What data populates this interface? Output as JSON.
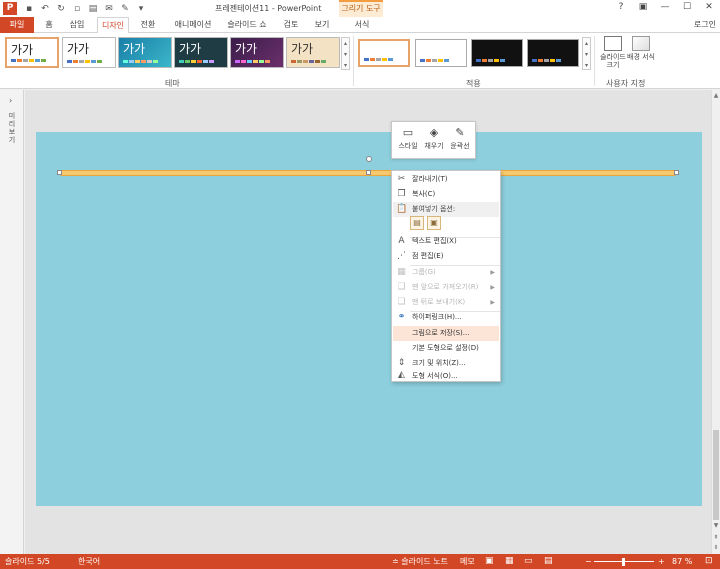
{
  "titlebar": {
    "app_icon": "P",
    "title": "프레젠테이션11 - PowerPoint",
    "contextual_group": "그리기 도구",
    "qat_icons": [
      "save-icon",
      "undo-icon",
      "redo-icon",
      "new-icon",
      "open-icon",
      "email-icon",
      "draw-icon",
      "customize-icon"
    ],
    "win_help": "?",
    "win_restore": "▣",
    "win_minimize": "—",
    "win_maximize": "☐",
    "win_close": "✕"
  },
  "tabs": [
    {
      "label": "파일"
    },
    {
      "label": "홈"
    },
    {
      "label": "삽입"
    },
    {
      "label": "디자인"
    },
    {
      "label": "전환"
    },
    {
      "label": "애니메이션"
    },
    {
      "label": "슬라이드 쇼"
    },
    {
      "label": "검토"
    },
    {
      "label": "보기"
    },
    {
      "label": "서식"
    }
  ],
  "login": "로그인",
  "ribbon": {
    "theme_sample_text": "가가",
    "themes_label": "테마",
    "variants_label": "적용",
    "slide_size_label": "슬라이드 크기",
    "background_label": "배경 서식",
    "customize_label": "사용자 지정"
  },
  "leftpane": {
    "expand_arrow": "›",
    "label": "미리 보기"
  },
  "minitoolbar": {
    "style_label": "스타일",
    "fill_label": "채우기",
    "outline_label": "윤곽선"
  },
  "context_menu": {
    "cut": "잘라내기(T)",
    "copy": "복사(C)",
    "paste_options": "붙여넣기 옵션:",
    "edit_text": "텍스트 편집(X)",
    "edit_points": "점 편집(E)",
    "group": "그룹(G)",
    "bring_to_front": "맨 앞으로 가져오기(R)",
    "send_to_back": "맨 뒤로 보내기(K)",
    "hyperlink": "하이퍼링크(H)...",
    "save_as_picture": "그림으로 저장(S)...",
    "set_default_shape": "기본 도형으로 설정(D)",
    "size_position": "크기 및 위치(Z)...",
    "format_shape": "도형 서식(O)..."
  },
  "statusbar": {
    "slide_info": "슬라이드 5/5",
    "language": "한국어",
    "notes": "≐ 슬라이드 노트",
    "comments": "메모",
    "zoom_minus": "−",
    "zoom_plus": "+",
    "zoom": "87 %"
  },
  "colors": {
    "accent": "#d24726",
    "slide_background": "#8dcfdd",
    "shape_fill": "#f6c870",
    "menu_highlight": "#fce4d6"
  }
}
